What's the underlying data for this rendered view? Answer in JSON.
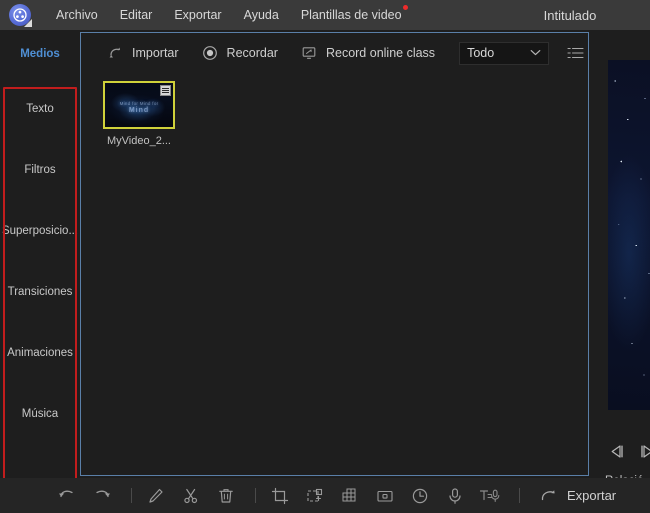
{
  "titlebar": {
    "logo_icon": "film-reel-icon",
    "menu": [
      {
        "label": "Archivo",
        "badge": false
      },
      {
        "label": "Editar",
        "badge": false
      },
      {
        "label": "Exportar",
        "badge": false
      },
      {
        "label": "Ayuda",
        "badge": false
      },
      {
        "label": "Plantillas de video",
        "badge": true
      }
    ],
    "document_title": "Intitulado"
  },
  "sidebar": {
    "items": [
      {
        "label": "Medios",
        "active": true
      },
      {
        "label": "Texto",
        "active": false
      },
      {
        "label": "Filtros",
        "active": false
      },
      {
        "label": "Superposicio...",
        "active": false
      },
      {
        "label": "Transiciones",
        "active": false
      },
      {
        "label": "Animaciones",
        "active": false
      },
      {
        "label": "Música",
        "active": false
      }
    ],
    "highlight_color": "#c21d1d"
  },
  "media_panel": {
    "border_color": "#5a7fa8",
    "toolbar": {
      "import_label": "Importar",
      "import_icon": "import-arrow-icon",
      "record_label": "Recordar",
      "record_icon": "record-circle-icon",
      "online_class_label": "Record online class",
      "online_class_icon": "screen-record-icon",
      "filter_value": "Todo",
      "filter_icon": "chevron-down-icon",
      "list_view_icon": "list-view-icon"
    },
    "items": [
      {
        "name": "MyVideo_2...",
        "selection_color": "#cfd13a",
        "thumb_overlay_line1": "Mind for Mind for",
        "thumb_overlay_line2": "Mind"
      }
    ]
  },
  "preview": {
    "prev_frame_icon": "previous-frame-icon",
    "next_frame_icon": "next-frame-icon",
    "aspect_ratio_label": "Relació"
  },
  "bottom_toolbar": {
    "icons": [
      "undo-icon",
      "redo-icon",
      "separator",
      "edit-pencil-icon",
      "cut-scissors-icon",
      "delete-trash-icon",
      "separator",
      "crop-icon",
      "add-frame-icon",
      "mosaic-grid-icon",
      "snapshot-icon",
      "speed-clock-icon",
      "voiceover-mic-icon",
      "text-to-speech-icon",
      "separator"
    ],
    "export_label": "Exportar",
    "export_icon": "export-arrow-icon"
  }
}
